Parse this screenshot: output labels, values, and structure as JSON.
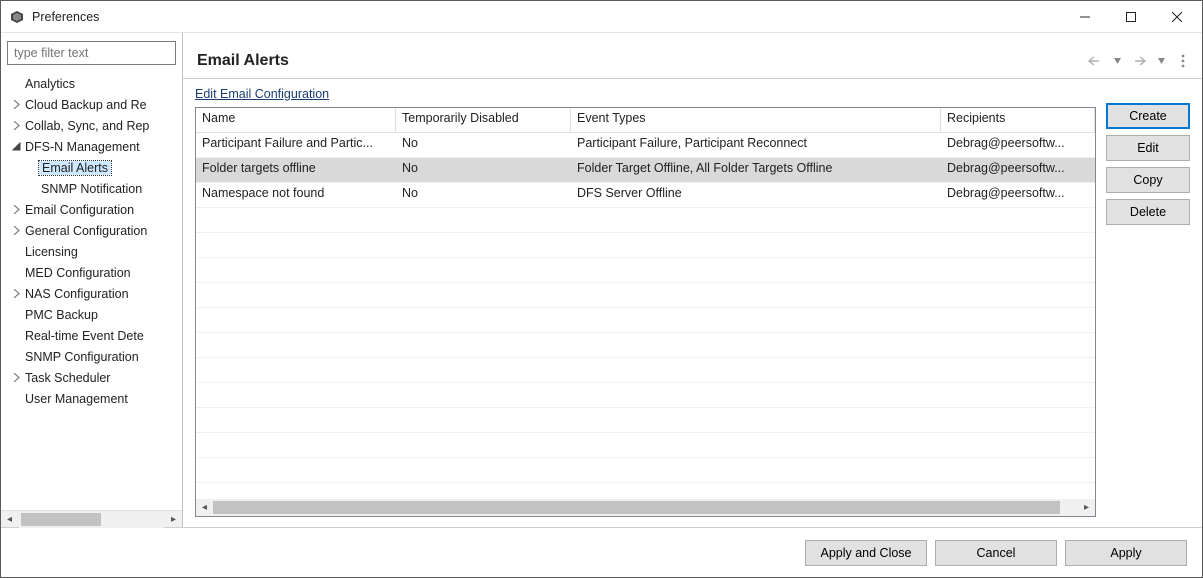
{
  "window": {
    "title": "Preferences"
  },
  "sidebar": {
    "filter_placeholder": "type filter text",
    "items": [
      {
        "label": "Analytics",
        "depth": 1,
        "expandable": false
      },
      {
        "label": "Cloud Backup and Re",
        "depth": 1,
        "expandable": true,
        "expanded": false
      },
      {
        "label": "Collab, Sync, and Rep",
        "depth": 1,
        "expandable": true,
        "expanded": false
      },
      {
        "label": "DFS-N Management",
        "depth": 1,
        "expandable": true,
        "expanded": true
      },
      {
        "label": "Email Alerts",
        "depth": 2,
        "selected": true
      },
      {
        "label": "SNMP Notification",
        "depth": 2
      },
      {
        "label": "Email Configuration",
        "depth": 1,
        "expandable": true,
        "expanded": false
      },
      {
        "label": "General Configuration",
        "depth": 1,
        "expandable": true,
        "expanded": false
      },
      {
        "label": "Licensing",
        "depth": 1,
        "expandable": false
      },
      {
        "label": "MED Configuration",
        "depth": 1,
        "expandable": false
      },
      {
        "label": "NAS Configuration",
        "depth": 1,
        "expandable": true,
        "expanded": false
      },
      {
        "label": "PMC Backup",
        "depth": 1,
        "expandable": false
      },
      {
        "label": "Real-time Event Dete",
        "depth": 1,
        "expandable": false
      },
      {
        "label": "SNMP Configuration",
        "depth": 1,
        "expandable": false
      },
      {
        "label": "Task Scheduler",
        "depth": 1,
        "expandable": true,
        "expanded": false
      },
      {
        "label": "User Management",
        "depth": 1,
        "expandable": false
      }
    ]
  },
  "main": {
    "title": "Email Alerts",
    "edit_link": "Edit Email Configuration",
    "columns": [
      "Name",
      "Temporarily Disabled",
      "Event Types",
      "Recipients"
    ],
    "rows": [
      {
        "name": "Participant Failure and Partic...",
        "disabled": "No",
        "event_types": "Participant Failure, Participant Reconnect",
        "recipients": "Debrag@peersoftw...",
        "selected": false
      },
      {
        "name": "Folder targets offline",
        "disabled": "No",
        "event_types": "Folder Target Offline, All Folder Targets Offline",
        "recipients": "Debrag@peersoftw...",
        "selected": true
      },
      {
        "name": "Namespace not found",
        "disabled": "No",
        "event_types": "DFS Server Offline",
        "recipients": "Debrag@peersoftw...",
        "selected": false
      }
    ],
    "empty_rows": 11,
    "buttons": {
      "create": "Create",
      "edit": "Edit",
      "copy": "Copy",
      "delete": "Delete"
    }
  },
  "footer": {
    "apply_close": "Apply and Close",
    "cancel": "Cancel",
    "apply": "Apply"
  }
}
